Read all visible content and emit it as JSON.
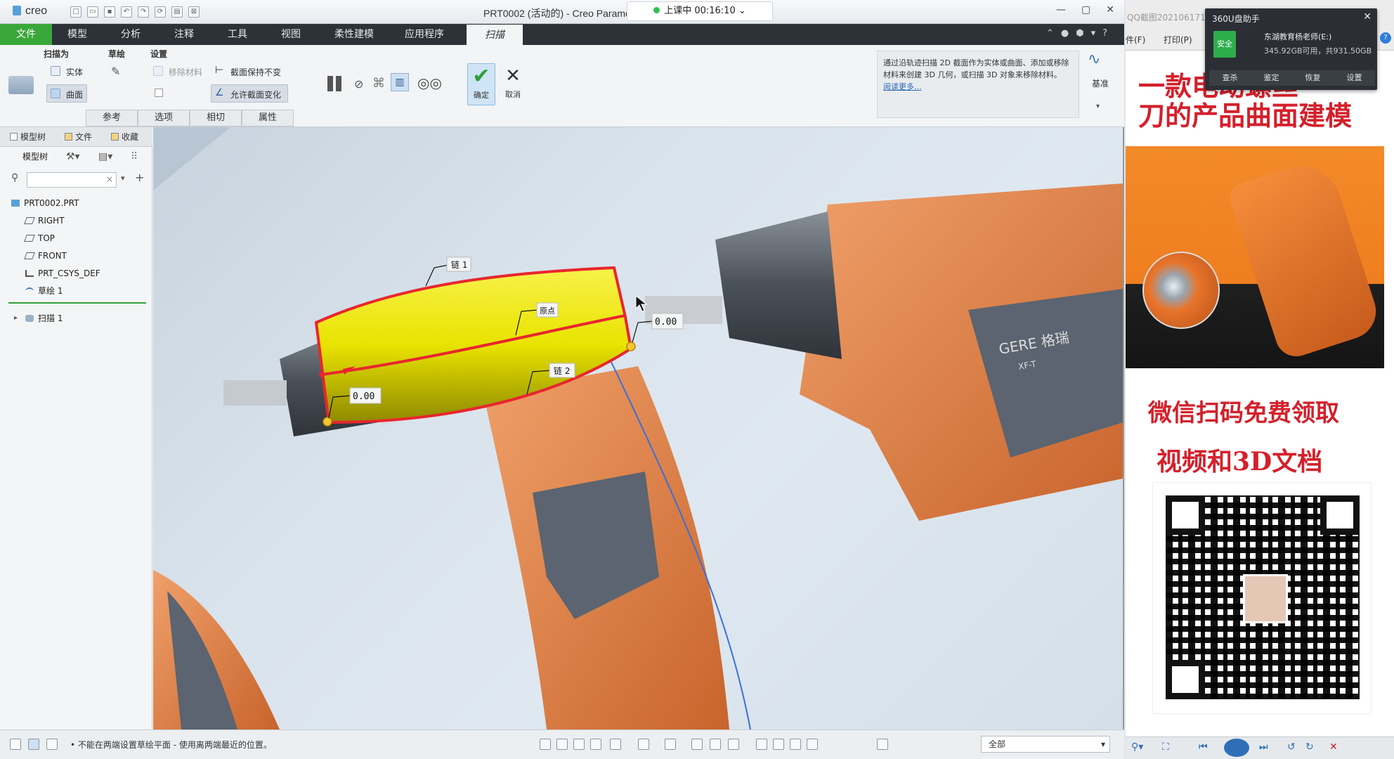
{
  "app": {
    "logo": "creo",
    "window_title": "PRT0002 (活动的) - Creo Parame",
    "timer": "上课中 00:16:10",
    "window_controls": [
      "—",
      "▢",
      "✕"
    ]
  },
  "menu": {
    "items": [
      "文件",
      "模型",
      "分析",
      "注释",
      "工具",
      "视图",
      "柔性建模",
      "应用程序",
      "扫描"
    ]
  },
  "ribbon": {
    "groups": {
      "sweep_as": "扫描为",
      "sketch": "草绘",
      "settings": "设置"
    },
    "solid": "实体",
    "surface": "曲面",
    "remove_material": "移除材料",
    "keep_section": "截面保持不变",
    "vary_section": "允许截面变化",
    "tabs": [
      "参考",
      "选项",
      "相切",
      "属性"
    ],
    "confirm": "确定",
    "cancel": "取消",
    "datum": "基准",
    "info": {
      "text": "通过沿轨迹扫描 2D 截面作为实体或曲面、添加或移除材料来创建 3D 几何，或扫描 3D 对象来移除材料。",
      "link": "阅读更多..."
    }
  },
  "left_panel": {
    "tabs": [
      "模型树",
      "文件",
      "收藏"
    ],
    "header": "模型树",
    "tree": [
      {
        "label": "PRT0002.PRT",
        "icon": "part-icon"
      },
      {
        "label": "RIGHT",
        "icon": "datum-plane-icon"
      },
      {
        "label": "TOP",
        "icon": "datum-plane-icon"
      },
      {
        "label": "FRONT",
        "icon": "datum-plane-icon"
      },
      {
        "label": "PRT_CSYS_DEF",
        "icon": "coord-sys-icon"
      },
      {
        "label": "草绘 1",
        "icon": "sketch-icon"
      },
      {
        "label": "扫描 1",
        "icon": "sweep-icon"
      }
    ]
  },
  "viewport": {
    "labels": {
      "chain1": "链 1",
      "origin": "原点",
      "chain2": "链 2",
      "dim_right": "0.00",
      "dim_left": "0.00"
    },
    "drill_labels": {
      "brand": "GERE 格瑞",
      "model": "XF-T"
    }
  },
  "status": {
    "message": "• 不能在两端设置草绘平面 - 使用离两端最近的位置。",
    "filter_select": "全部"
  },
  "side_panel": {
    "header_tab": "QQ截图2021061716",
    "menu": [
      "件(F)",
      "打印(P)"
    ],
    "popup": {
      "title": "360U盘助手",
      "badge": "安全",
      "drive": "东湖教育杨老师(E:)",
      "space": "345.92GB可用，共931.50GB",
      "actions": [
        "查杀",
        "鉴定",
        "恢复",
        "设置"
      ]
    },
    "promo_line1": "一款电动螺丝",
    "promo_line2": "刀的产品曲面建模",
    "promo_line3": "微信扫码免费领取",
    "promo_line4": "视频和3D文档"
  }
}
